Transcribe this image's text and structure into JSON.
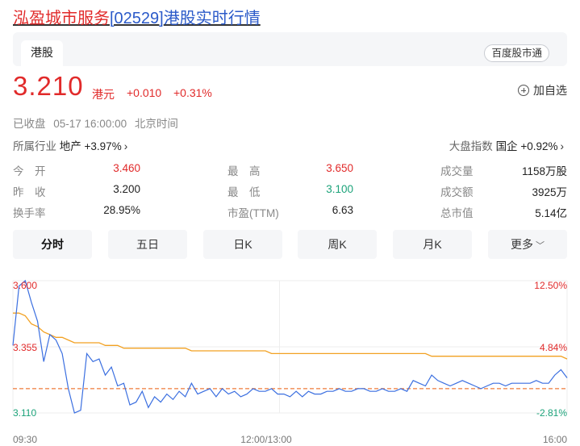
{
  "header": {
    "name": "泓盈城市服务",
    "code": "[02529]",
    "suffix": "港股实时行情"
  },
  "tabs": {
    "hk": "港股",
    "tong": "百度股市通"
  },
  "quote": {
    "price": "3.210",
    "unit": "港元",
    "change": "+0.010",
    "change_pct": "+0.31%",
    "add_fav": "加自选"
  },
  "status": {
    "state": "已收盘",
    "time": "05-17 16:00:00",
    "zone": "北京时间"
  },
  "industry": {
    "label": "所属行业",
    "name": "地产",
    "change": "+3.97%"
  },
  "market_index": {
    "label": "大盘指数",
    "name": "国企",
    "change": "+0.92%"
  },
  "stats": {
    "open_label": "今　开",
    "open": "3.460",
    "prev_label": "昨　收",
    "prev": "3.200",
    "turnover_label": "换手率",
    "turnover": "28.95%",
    "high_label": "最　高",
    "high": "3.650",
    "low_label": "最　低",
    "low": "3.100",
    "pe_label": "市盈(TTM)",
    "pe": "6.63",
    "volume_label": "成交量",
    "volume": "1158万股",
    "amount_label": "成交额",
    "amount": "3925万",
    "mktcap_label": "总市值",
    "mktcap": "5.14亿"
  },
  "periods": [
    "分时",
    "五日",
    "日K",
    "周K",
    "月K",
    "更多"
  ],
  "colors": {
    "up": "#e12a2a",
    "down": "#1ca37a",
    "price_line": "#3b6fe0",
    "avg_line": "#f2a122"
  },
  "chart_data": {
    "type": "line",
    "x_labels": [
      "09:30",
      "12:00/13:00",
      "16:00"
    ],
    "y_left": [
      "3.600",
      "3.355",
      "3.110"
    ],
    "y_right": [
      "12.50%",
      "4.84%",
      "-2.81%"
    ],
    "ylim": [
      3.11,
      3.6
    ],
    "prev_close": 3.2,
    "series": [
      {
        "values": [
          3.36,
          3.58,
          3.6,
          3.52,
          3.45,
          3.3,
          3.4,
          3.38,
          3.33,
          3.2,
          3.11,
          3.12,
          3.33,
          3.3,
          3.31,
          3.25,
          3.28,
          3.21,
          3.22,
          3.14,
          3.15,
          3.19,
          3.13,
          3.17,
          3.15,
          3.18,
          3.16,
          3.19,
          3.17,
          3.22,
          3.18,
          3.19,
          3.2,
          3.17,
          3.2,
          3.18,
          3.19,
          3.17,
          3.18,
          3.2,
          3.19,
          3.19,
          3.2,
          3.18,
          3.18,
          3.17,
          3.19,
          3.17,
          3.19,
          3.18,
          3.18,
          3.19,
          3.19,
          3.2,
          3.19,
          3.19,
          3.2,
          3.2,
          3.19,
          3.19,
          3.2,
          3.19,
          3.19,
          3.2,
          3.19,
          3.23,
          3.22,
          3.21,
          3.25,
          3.23,
          3.22,
          3.21,
          3.22,
          3.23,
          3.22,
          3.21,
          3.2,
          3.21,
          3.22,
          3.22,
          3.21,
          3.22,
          3.22,
          3.22,
          3.22,
          3.23,
          3.22,
          3.22,
          3.25,
          3.27,
          3.24
        ]
      },
      {
        "values": [
          3.48,
          3.48,
          3.47,
          3.44,
          3.43,
          3.41,
          3.4,
          3.39,
          3.39,
          3.38,
          3.37,
          3.37,
          3.37,
          3.37,
          3.37,
          3.36,
          3.36,
          3.36,
          3.35,
          3.35,
          3.35,
          3.35,
          3.35,
          3.35,
          3.35,
          3.35,
          3.35,
          3.35,
          3.35,
          3.34,
          3.34,
          3.34,
          3.34,
          3.34,
          3.34,
          3.34,
          3.34,
          3.34,
          3.34,
          3.34,
          3.34,
          3.34,
          3.33,
          3.33,
          3.33,
          3.33,
          3.33,
          3.33,
          3.33,
          3.33,
          3.33,
          3.33,
          3.33,
          3.33,
          3.33,
          3.33,
          3.33,
          3.33,
          3.33,
          3.33,
          3.33,
          3.33,
          3.33,
          3.33,
          3.33,
          3.33,
          3.33,
          3.33,
          3.32,
          3.32,
          3.32,
          3.32,
          3.32,
          3.32,
          3.32,
          3.32,
          3.32,
          3.32,
          3.32,
          3.32,
          3.32,
          3.32,
          3.32,
          3.32,
          3.32,
          3.32,
          3.32,
          3.32,
          3.32,
          3.32,
          3.31
        ]
      }
    ]
  }
}
